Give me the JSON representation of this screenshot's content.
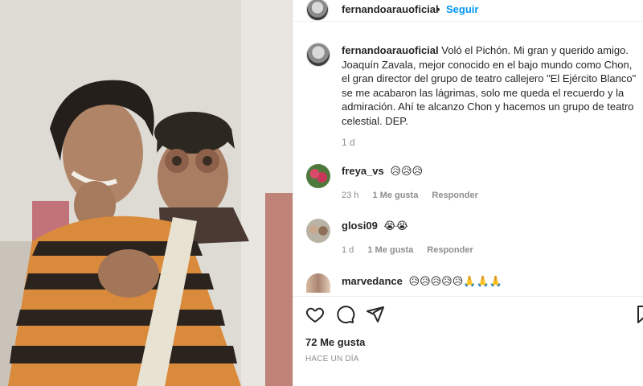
{
  "post": {
    "author": "fernandoarauoficial",
    "separator": "•",
    "follow_label": "Seguir",
    "more_label": "…"
  },
  "caption": {
    "username": "fernandoarauoficial",
    "text": "Voló el Pichón. Mi gran y querido amigo. Joaquín Zavala, mejor conocido en el bajo mundo como Chon, el gran director del grupo de teatro callejero \"El Ejército Blanco\" se me acabaron las lágrimas, solo me queda el recuerdo y la admiración. Ahí te alcanzo Chon y hacemos un grupo de teatro celestial. DEP.",
    "time": "1 d"
  },
  "comments": [
    {
      "username": "freya_vs",
      "text": "😥😥😥",
      "time": "23 h",
      "likes": "1 Me gusta",
      "reply": "Responder"
    },
    {
      "username": "glosi09",
      "text": "😭😭",
      "time": "1 d",
      "likes": "1 Me gusta",
      "reply": "Responder"
    },
    {
      "username": "marvedance",
      "text": "😥😥😥😥😥🙏🙏🙏",
      "time": "",
      "likes": "",
      "reply": ""
    }
  ],
  "actions": {
    "like_icon": "heart-icon",
    "comment_icon": "comment-icon",
    "share_icon": "share-icon",
    "save_icon": "bookmark-icon"
  },
  "stats": {
    "likes": "72 Me gusta",
    "posted": "HACE UN DÍA"
  },
  "colors": {
    "follow": "#0095f6",
    "muted": "#8e8e8e",
    "text": "#262626"
  }
}
